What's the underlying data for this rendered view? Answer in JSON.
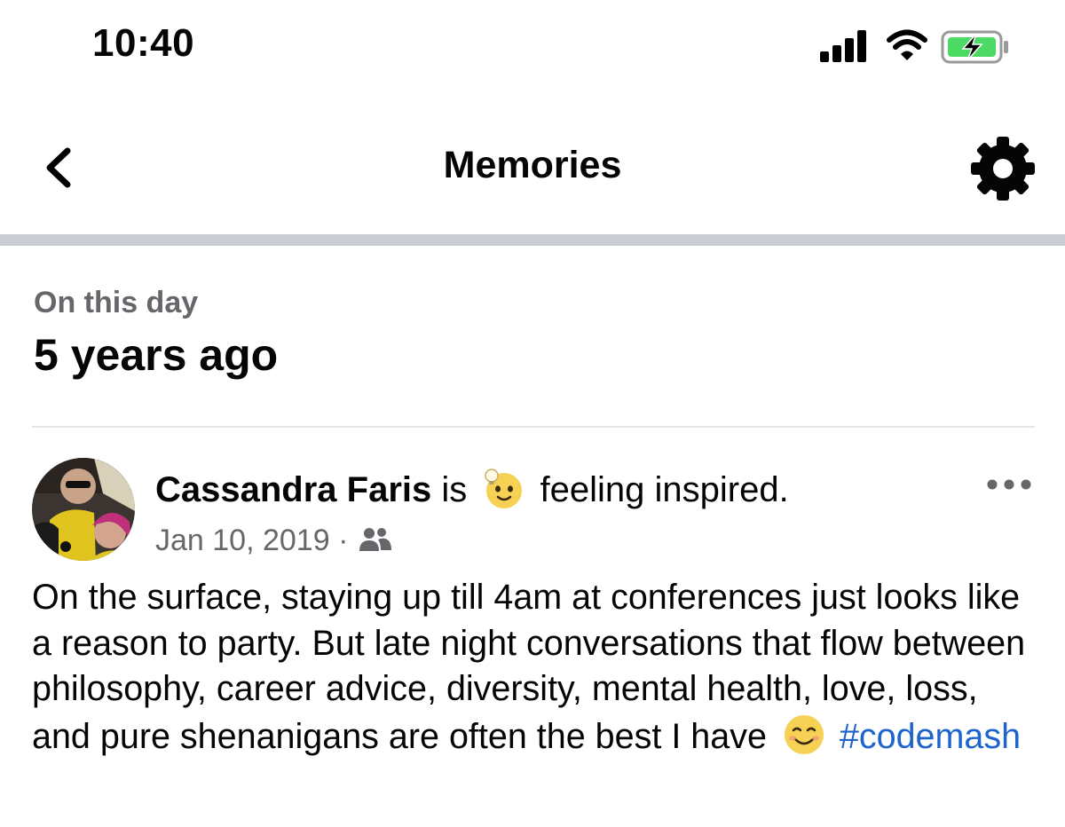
{
  "status_bar": {
    "time": "10:40",
    "icons": [
      "cellular-signal-icon",
      "wifi-icon",
      "battery-charging-icon"
    ],
    "battery_color": "#4cd964"
  },
  "nav": {
    "title": "Memories",
    "back_icon": "chevron-left-icon",
    "settings_icon": "gear-icon"
  },
  "section": {
    "subtitle": "On this day",
    "title": "5 years ago"
  },
  "post": {
    "author": "Cassandra Faris",
    "is_text": "is",
    "feeling_icon": "inspired-emoji-icon",
    "feeling_text": "feeling inspired.",
    "date": "Jan 10, 2019",
    "separator": "·",
    "audience_icon": "friends-icon",
    "more_icon": "more-options-icon",
    "body": "On the surface, staying up till 4am at conferences just looks like a reason to party. But late night conversations that flow between philosophy, career advice, diversity, mental health, love, loss, and pure shenanigans are often the best I have",
    "body_emoji": "smiling-face-icon",
    "hashtag": "#codemash",
    "hashtag_color": "#1f64cc"
  },
  "colors": {
    "text_primary": "#050505",
    "text_secondary": "#65676b",
    "divider": "#c9ccd1"
  }
}
